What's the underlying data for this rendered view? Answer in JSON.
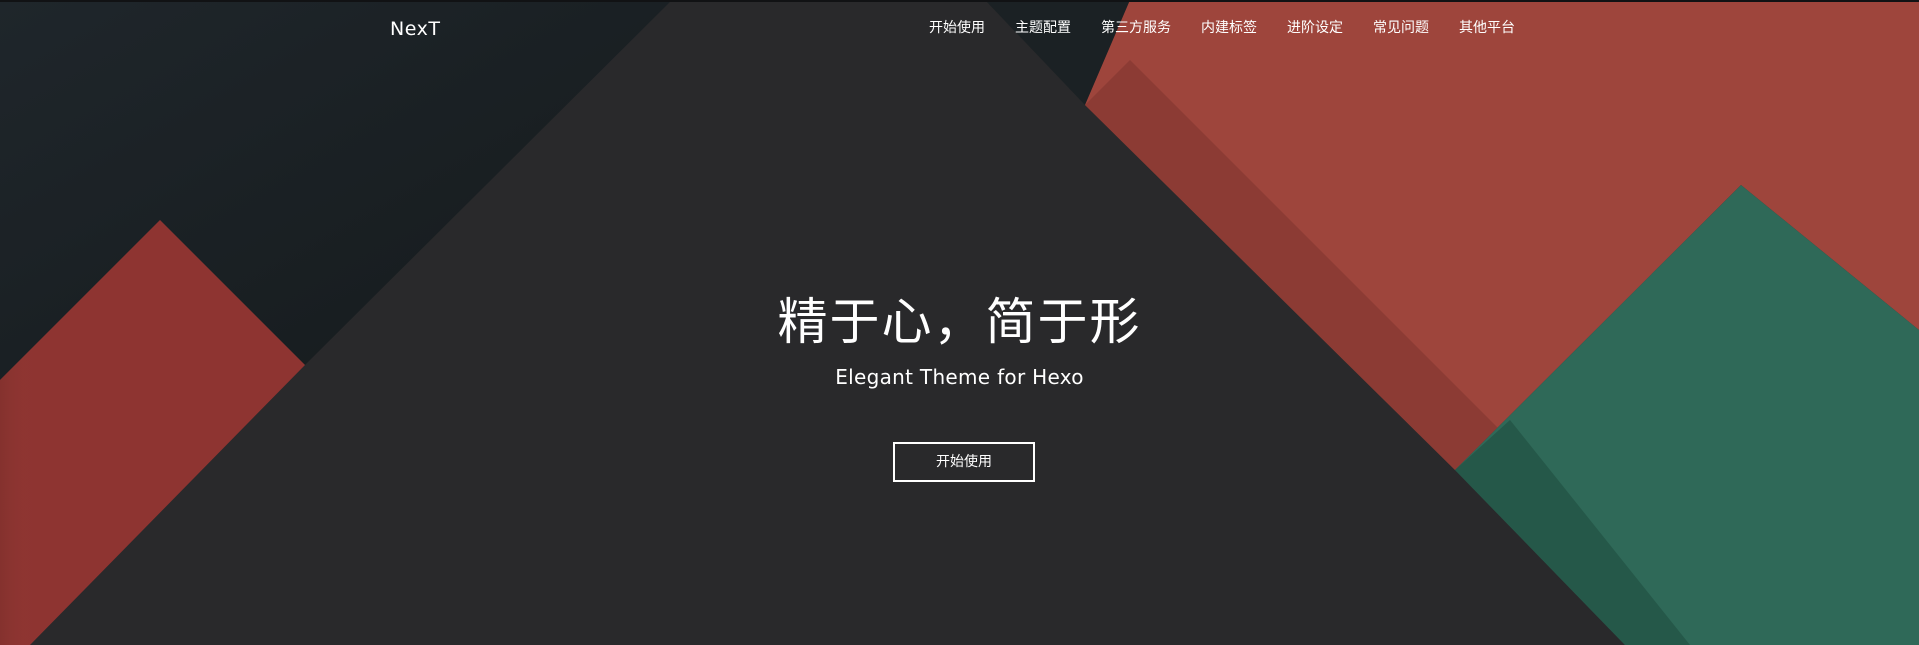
{
  "brand": {
    "name": "NexT"
  },
  "nav": {
    "items": [
      {
        "label": "开始使用"
      },
      {
        "label": "主题配置"
      },
      {
        "label": "第三方服务"
      },
      {
        "label": "内建标签"
      },
      {
        "label": "进阶设定"
      },
      {
        "label": "常见问题"
      },
      {
        "label": "其他平台"
      }
    ]
  },
  "hero": {
    "title": "精于心，简于形",
    "subtitle": "Elegant Theme for Hexo",
    "cta_label": "开始使用"
  },
  "colors": {
    "background": "#29292b",
    "navy": "#1c2226",
    "red": "#9e453c",
    "dark_red": "#8e3431",
    "green": "#2f6958",
    "text": "#ffffff"
  }
}
